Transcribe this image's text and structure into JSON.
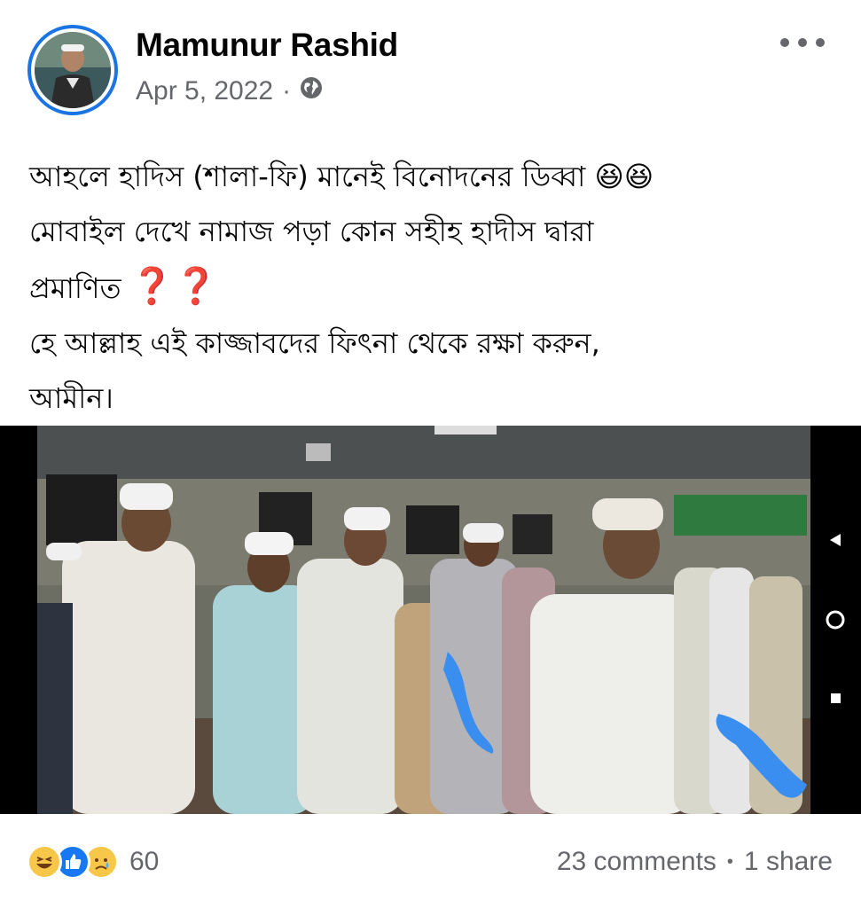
{
  "post": {
    "author": "Mamunur Rashid",
    "date": "Apr 5, 2022",
    "separator": "·",
    "privacy_icon": "globe-icon",
    "more_icon": "more-options-icon",
    "text_lines": [
      "আহলে হাদিস (শালা-ফি) মানেই বিনোদনের ডিব্বা",
      "মোবাইল দেখে নামাজ পড়া কোন সহীহ হাদীস দ্বারা",
      "প্রমাণিত",
      "হে আল্লাহ এই কাজ্জাবদের ফিৎনা থেকে রক্ষা করুন,",
      "আমীন।"
    ],
    "line1_emojis": "😆😆",
    "line3_marks": "❓❓"
  },
  "footer": {
    "reaction_icons": [
      "haha-reaction-icon",
      "like-reaction-icon",
      "sad-reaction-icon"
    ],
    "reaction_count": "60",
    "comments": "23 comments",
    "dot": "•",
    "shares": "1 share"
  },
  "colors": {
    "accent": "#1b74e4",
    "secondary_text": "#65676b",
    "highlight_blue": "#3a8ef0"
  }
}
